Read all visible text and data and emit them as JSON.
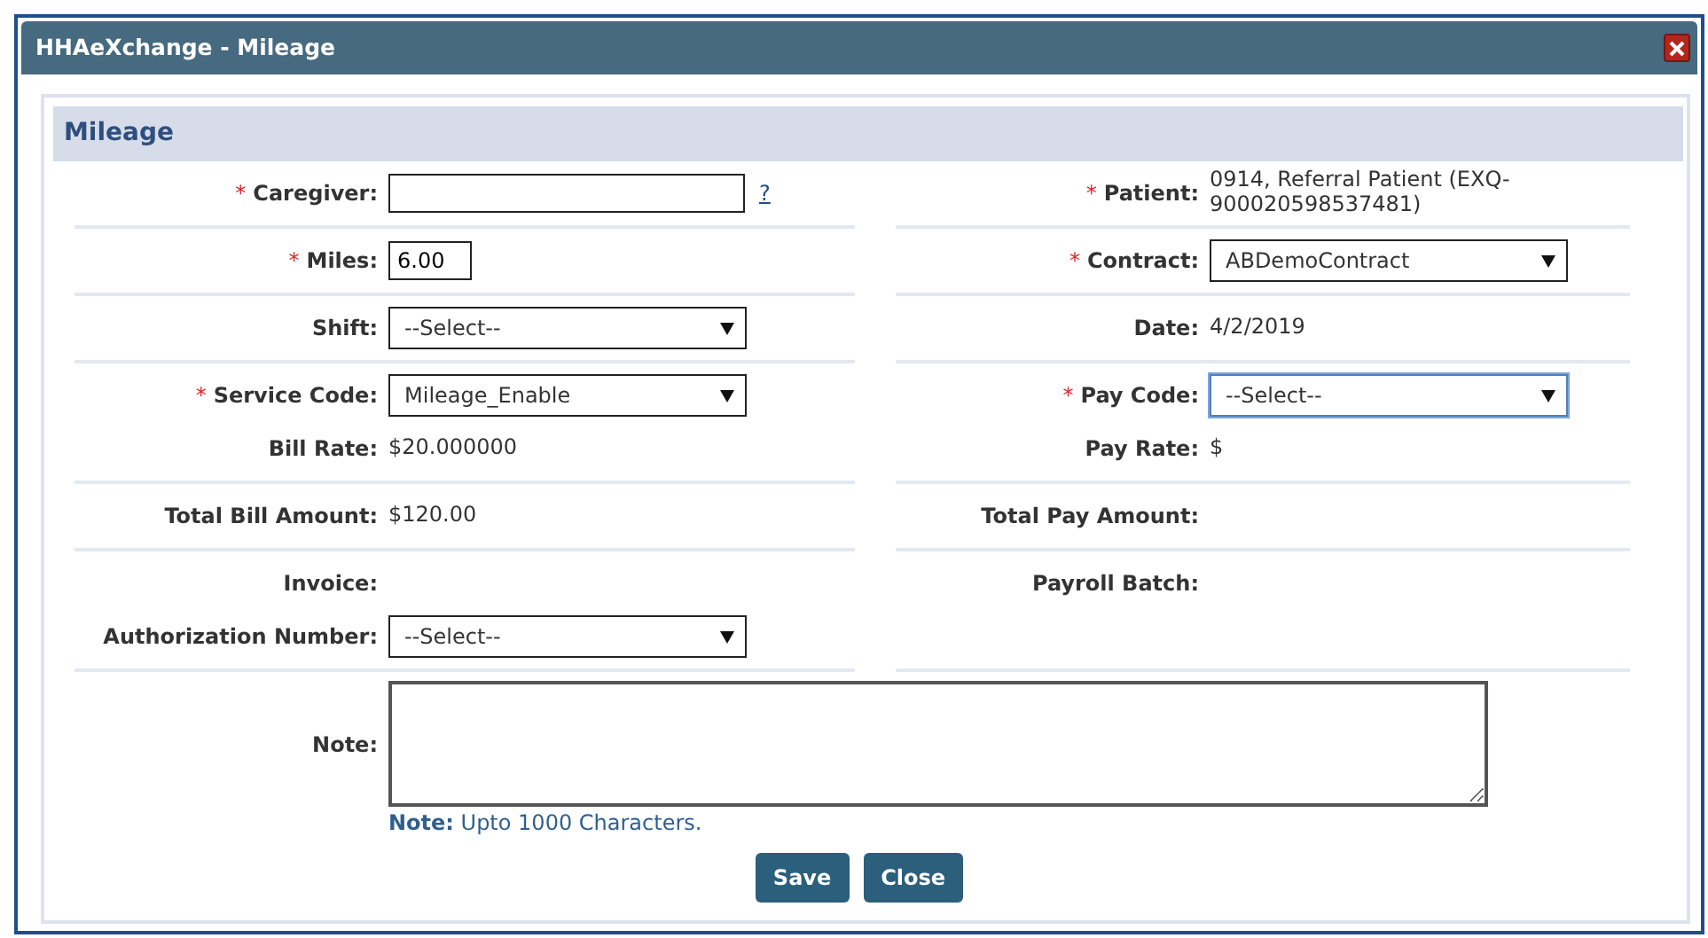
{
  "window": {
    "title": "HHAeXchange - Mileage"
  },
  "section": {
    "title": "Mileage"
  },
  "rows": [
    {
      "left": [
        {
          "label": "Caregiver:",
          "required_mark": "*",
          "kind": "input",
          "help_link": "?"
        }
      ],
      "right": [
        {
          "label": "Patient:",
          "required_mark": "*",
          "kind": "text",
          "value": "0914, Referral Patient (EXQ-900020598537481)"
        }
      ]
    },
    {
      "left": [
        {
          "label": "Miles:",
          "required_mark": "*",
          "kind": "number",
          "value": "6.00"
        }
      ],
      "right": [
        {
          "label": "Contract:",
          "required_mark": "*",
          "kind": "select",
          "value": "ABDemoContract",
          "focused": false
        }
      ]
    },
    {
      "left": [
        {
          "label": "Shift:",
          "kind": "select",
          "value": "--Select--",
          "focused": false
        }
      ],
      "right": [
        {
          "label": "Date:",
          "kind": "text",
          "value": "4/2/2019"
        }
      ]
    },
    {
      "left": [
        {
          "label": "Service Code:",
          "required_mark": "*",
          "kind": "select",
          "value": "Mileage_Enable",
          "focused": false
        },
        {
          "label": "Bill Rate:",
          "kind": "text",
          "value": "$20.000000"
        }
      ],
      "right": [
        {
          "label": "Pay Code:",
          "required_mark": "*",
          "kind": "select",
          "value": "--Select--",
          "focused": true
        },
        {
          "label": "Pay Rate:",
          "kind": "text",
          "value": "$"
        }
      ]
    },
    {
      "left": [
        {
          "label": "Total Bill Amount:",
          "kind": "text",
          "value": "$120.00"
        }
      ],
      "right": [
        {
          "label": "Total Pay Amount:",
          "kind": "text"
        }
      ]
    },
    {
      "left": [
        {
          "label": "Invoice:",
          "kind": "text"
        },
        {
          "label": "Authorization Number:",
          "kind": "select",
          "value": "--Select--",
          "focused": false
        }
      ],
      "right": [
        {
          "label": "Payroll Batch:",
          "kind": "text"
        }
      ]
    }
  ],
  "note": {
    "label": "Note:",
    "hint": "**Note:** Upto 1000 Characters."
  },
  "buttons": [
    "Save",
    "Close"
  ]
}
